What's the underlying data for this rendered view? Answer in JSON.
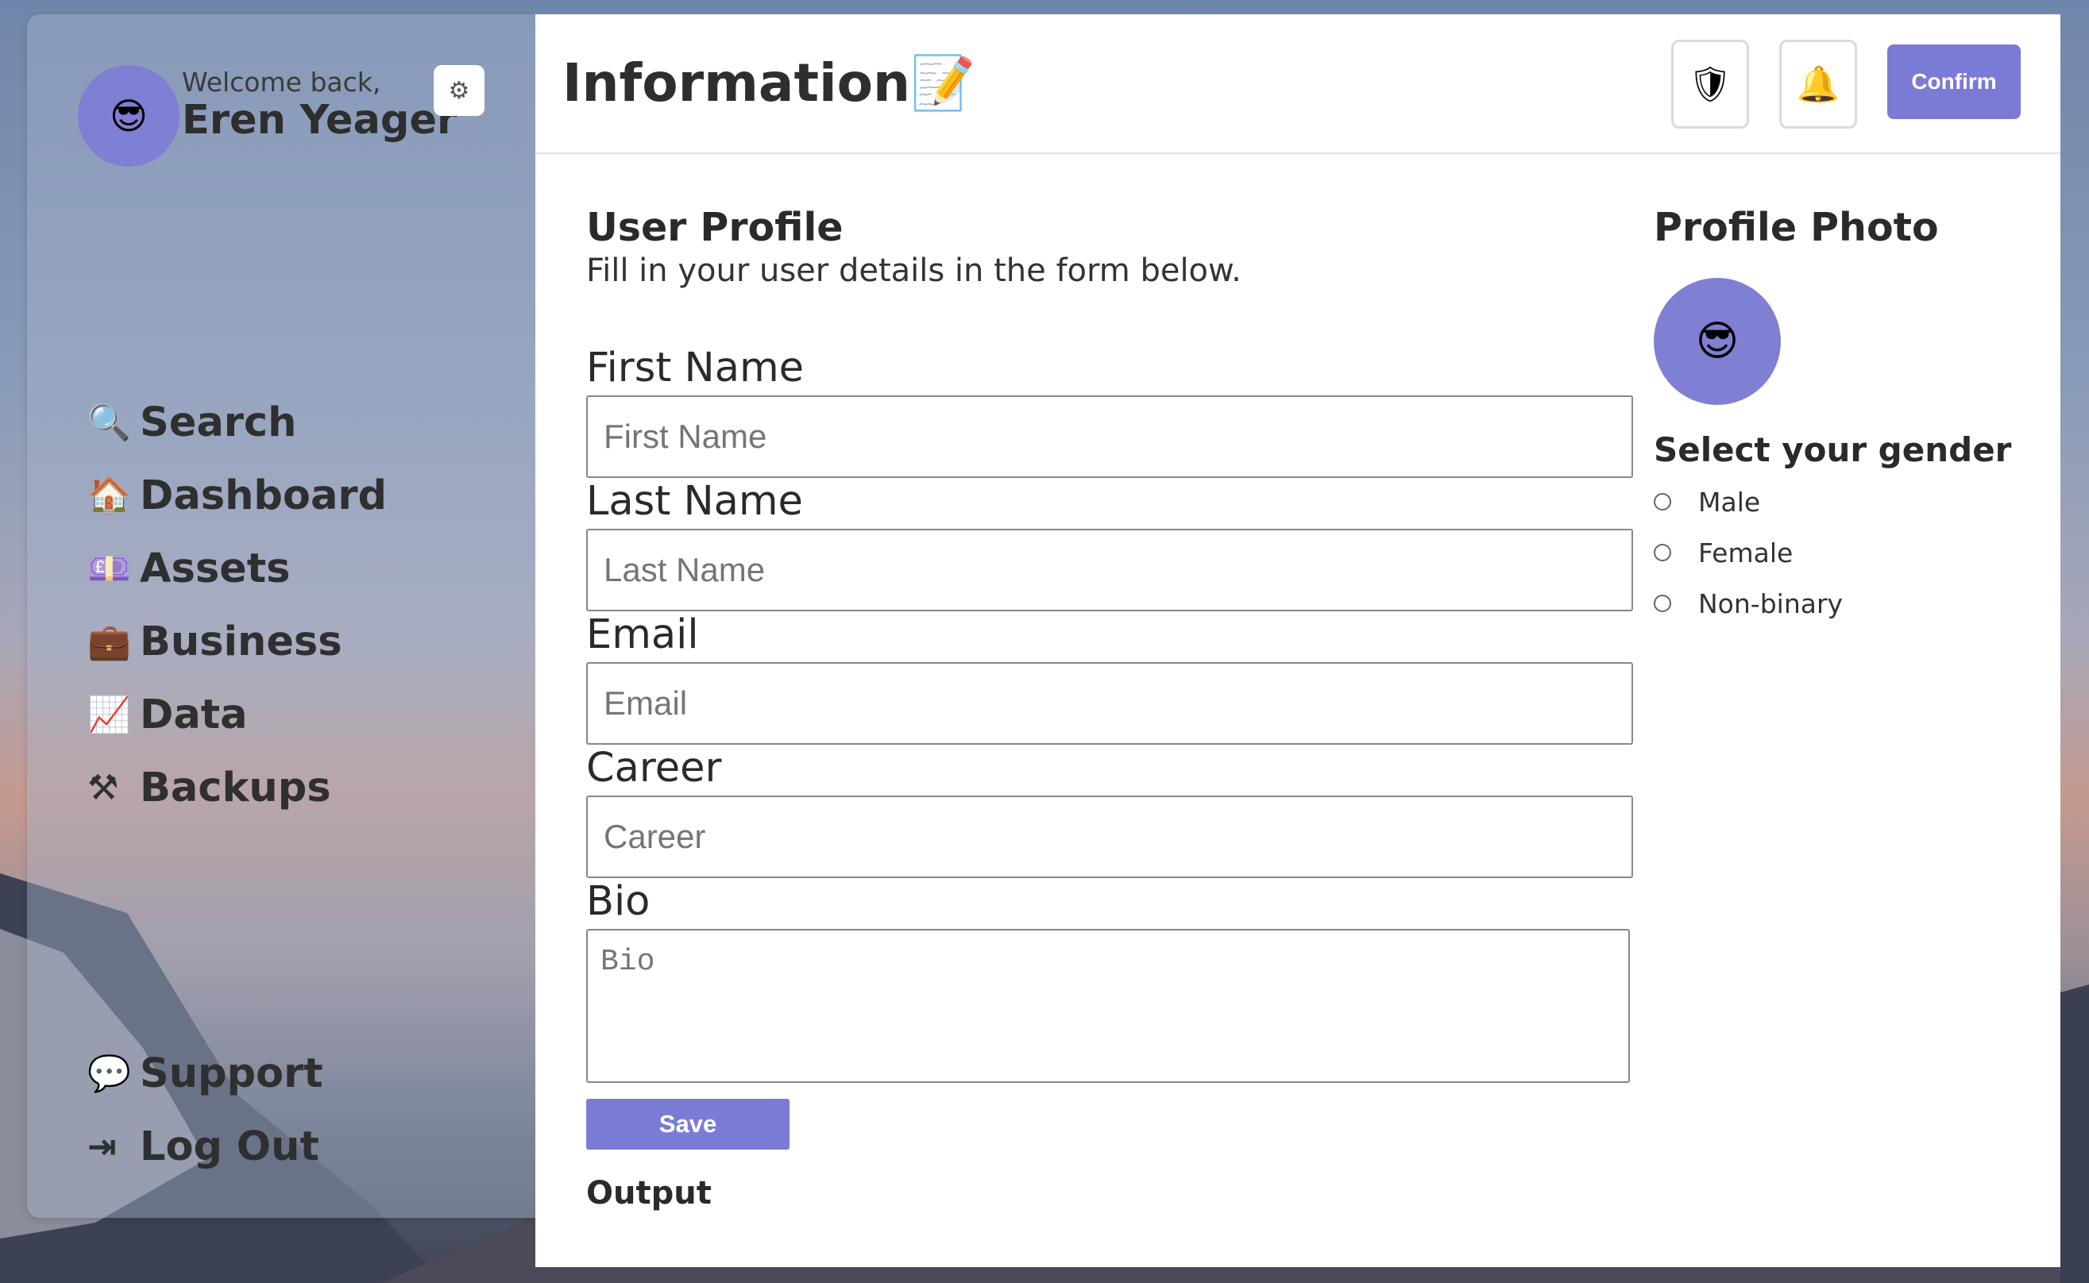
{
  "sidebar": {
    "avatar_emoji": "😎",
    "welcome": "Welcome back,",
    "username": "Eren Yeager",
    "settings_glyph": "⚙",
    "items": [
      {
        "icon": "🔍",
        "label": "Search"
      },
      {
        "icon": "🏠",
        "label": "Dashboard"
      },
      {
        "icon": "💷",
        "label": "Assets"
      },
      {
        "icon": "💼",
        "label": "Business"
      },
      {
        "icon": "📈",
        "label": "Data"
      },
      {
        "icon": "⚒",
        "label": "Backups"
      }
    ],
    "bottom_items": [
      {
        "icon": "💬",
        "label": "Support"
      },
      {
        "icon": "⇥",
        "label": "Log Out"
      }
    ]
  },
  "header": {
    "title": "Information📝",
    "shield_glyph": "🛡",
    "bell_glyph": "🔔",
    "confirm_label": "Confirm"
  },
  "profile": {
    "title": "User Profile",
    "subtitle": "Fill in your user details in the form below.",
    "fields": {
      "first_name": {
        "label": "First Name",
        "placeholder": "First Name",
        "value": ""
      },
      "last_name": {
        "label": "Last Name",
        "placeholder": "Last Name",
        "value": ""
      },
      "email": {
        "label": "Email",
        "placeholder": "Email",
        "value": ""
      },
      "career": {
        "label": "Career",
        "placeholder": "Career",
        "value": ""
      },
      "bio": {
        "label": "Bio",
        "placeholder": "Bio",
        "value": ""
      }
    },
    "save_label": "Save",
    "output_label": "Output"
  },
  "photo": {
    "title": "Profile Photo",
    "emoji": "😎",
    "gender_title": "Select your gender",
    "gender_options": [
      "Male",
      "Female",
      "Non-binary"
    ]
  },
  "colors": {
    "accent": "#7b7bd6",
    "avatar_bg": "#7f7fd4"
  }
}
